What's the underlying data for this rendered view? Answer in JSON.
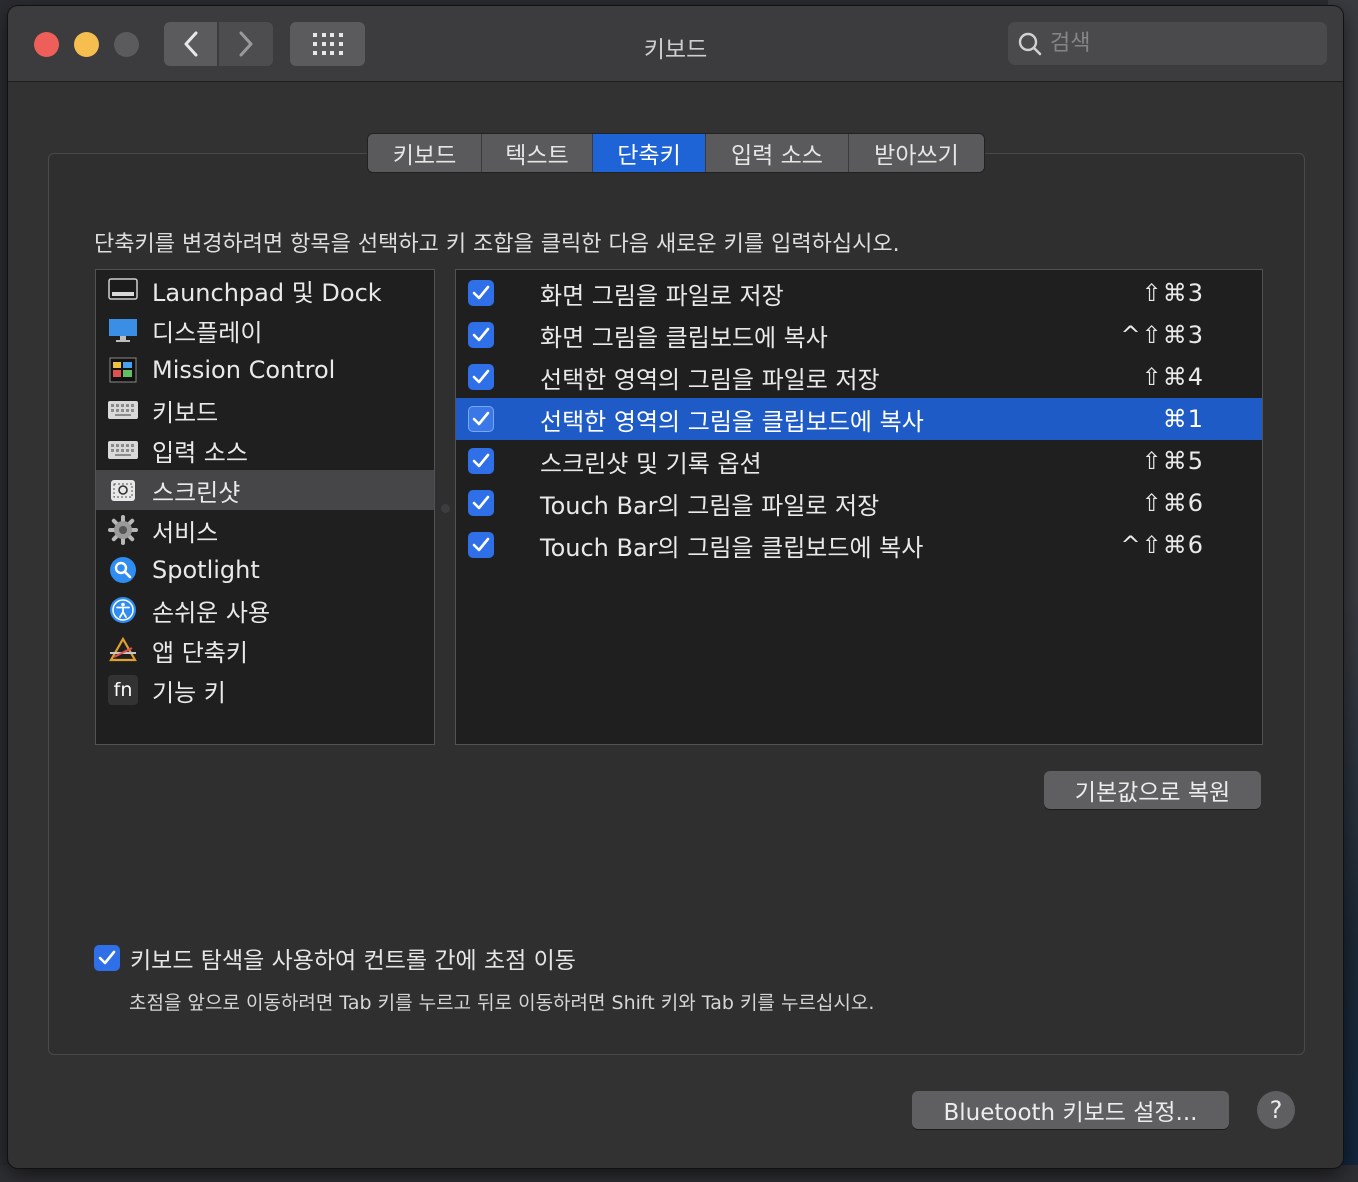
{
  "window": {
    "title": "키보드",
    "search_placeholder": "검색"
  },
  "tabs": [
    {
      "label": "키보드",
      "active": false
    },
    {
      "label": "텍스트",
      "active": false
    },
    {
      "label": "단축키",
      "active": true
    },
    {
      "label": "입력 소스",
      "active": false
    },
    {
      "label": "받아쓰기",
      "active": false
    }
  ],
  "instruction": "단축키를 변경하려면 항목을 선택하고 키 조합을 클릭한 다음 새로운 키를 입력하십시오.",
  "categories": [
    {
      "label": "Launchpad 및 Dock",
      "icon": "launchpad-dock-icon",
      "selected": false
    },
    {
      "label": "디스플레이",
      "icon": "display-icon",
      "selected": false
    },
    {
      "label": "Mission Control",
      "icon": "mission-control-icon",
      "selected": false
    },
    {
      "label": "키보드",
      "icon": "keyboard-icon",
      "selected": false
    },
    {
      "label": "입력 소스",
      "icon": "input-source-icon",
      "selected": false
    },
    {
      "label": "스크린샷",
      "icon": "screenshot-icon",
      "selected": true
    },
    {
      "label": "서비스",
      "icon": "gear-icon",
      "selected": false
    },
    {
      "label": "Spotlight",
      "icon": "spotlight-icon",
      "selected": false
    },
    {
      "label": "손쉬운 사용",
      "icon": "accessibility-icon",
      "selected": false
    },
    {
      "label": "앱 단축키",
      "icon": "app-shortcuts-icon",
      "selected": false
    },
    {
      "label": "기능 키",
      "icon": "fn-key-icon",
      "icon_text": "fn",
      "selected": false
    }
  ],
  "shortcuts": [
    {
      "label": "화면 그림을 파일로 저장",
      "keys": "⇧⌘3",
      "checked": true,
      "selected": false
    },
    {
      "label": "화면 그림을 클립보드에 복사",
      "keys": "^⇧⌘3",
      "checked": true,
      "selected": false
    },
    {
      "label": "선택한 영역의 그림을 파일로 저장",
      "keys": "⇧⌘4",
      "checked": true,
      "selected": false
    },
    {
      "label": "선택한 영역의 그림을 클립보드에 복사",
      "keys": "⌘1",
      "checked": true,
      "selected": true
    },
    {
      "label": "스크린샷 및 기록 옵션",
      "keys": "⇧⌘5",
      "checked": true,
      "selected": false
    },
    {
      "label": "Touch Bar의 그림을 파일로 저장",
      "keys": "⇧⌘6",
      "checked": true,
      "selected": false
    },
    {
      "label": "Touch Bar의 그림을 클립보드에 복사",
      "keys": "^⇧⌘6",
      "checked": true,
      "selected": false
    }
  ],
  "restore_button": "기본값으로 복원",
  "keyboard_navigation": {
    "label": "키보드 탐색을 사용하여 컨트롤 간에 초점 이동",
    "checked": true,
    "note": "초점을 앞으로 이동하려면 Tab 키를 누르고 뒤로 이동하려면 Shift 키와 Tab 키를 누르십시오."
  },
  "bluetooth_button": "Bluetooth 키보드 설정...",
  "help_button": "?",
  "colors": {
    "accent": "#1e64d6",
    "selection": "#1e5bc6",
    "close": "#ed5f58",
    "minimize": "#f5be4f"
  }
}
